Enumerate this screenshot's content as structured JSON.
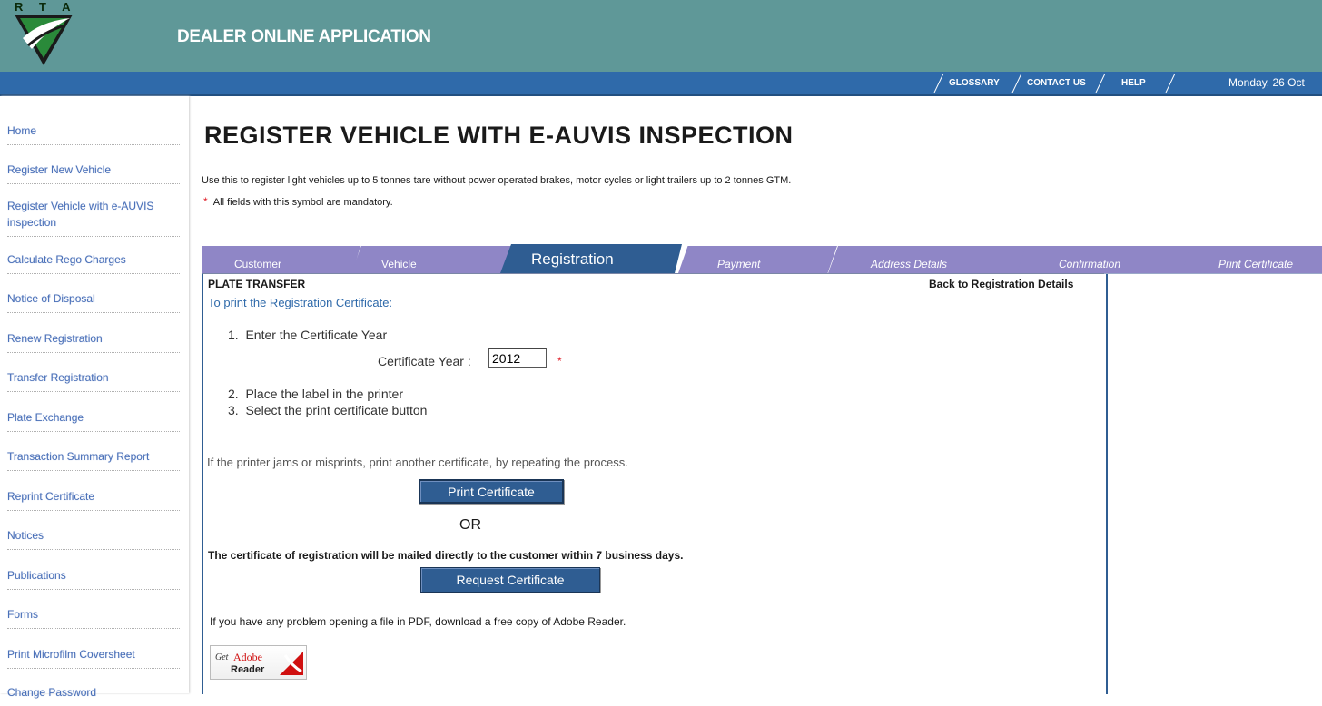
{
  "header": {
    "logo_text": "R T A",
    "app_title": "DEALER ONLINE APPLICATION"
  },
  "topnav": {
    "glossary": "GLOSSARY",
    "contact": "CONTACT US",
    "help": "HELP",
    "date": "Monday, 26 Oct"
  },
  "sidebar": {
    "items": [
      {
        "label": "Home"
      },
      {
        "label": "Register New Vehicle"
      },
      {
        "label": "Register Vehicle with e-AUVIS inspection"
      },
      {
        "label": "Calculate Rego Charges"
      },
      {
        "label": "Notice of Disposal"
      },
      {
        "label": "Renew Registration"
      },
      {
        "label": "Transfer Registration"
      },
      {
        "label": "Plate Exchange"
      },
      {
        "label": "Transaction Summary Report"
      },
      {
        "label": "Reprint Certificate"
      },
      {
        "label": "Notices"
      },
      {
        "label": "Publications"
      },
      {
        "label": "Forms"
      },
      {
        "label": "Print Microfilm Coversheet"
      },
      {
        "label": "Change Password"
      }
    ]
  },
  "main": {
    "title": "REGISTER VEHICLE WITH E-AUVIS INSPECTION",
    "intro": "Use this to register light vehicles up to 5 tonnes tare without power operated brakes, motor cycles or light trailers up to 2 tonnes GTM.",
    "required_symbol": "*",
    "mandatory_note": "All fields with this symbol are mandatory.",
    "tabs": [
      {
        "label": "Customer"
      },
      {
        "label": "Vehicle"
      },
      {
        "label": "Registration"
      },
      {
        "label": "Payment"
      },
      {
        "label": "Address Details"
      },
      {
        "label": "Confirmation"
      },
      {
        "label": "Print Certificate"
      }
    ],
    "section_title": "PLATE TRANSFER",
    "back_link": "Back to Registration Details",
    "to_print": "To print the Registration Certificate:",
    "step1": "1.  Enter the Certificate Year",
    "cert_year_label": "Certificate Year :",
    "cert_year_value": "2012",
    "step2": "2.  Place the label in the printer",
    "step3": "3.  Select the print certificate button",
    "jam_text": "If the printer jams or misprints, print another certificate, by repeating the process.",
    "print_button": "Print Certificate",
    "or_text": "OR",
    "mailed_text": "The certificate of registration will be mailed directly to the customer within 7 business days.",
    "request_button": "Request Certificate",
    "pdf_text": "If you have any problem opening a file in PDF, download a free copy of Adobe Reader.",
    "adobe_get": "Get",
    "adobe_brand": "Adobe",
    "adobe_reader": "Reader"
  }
}
